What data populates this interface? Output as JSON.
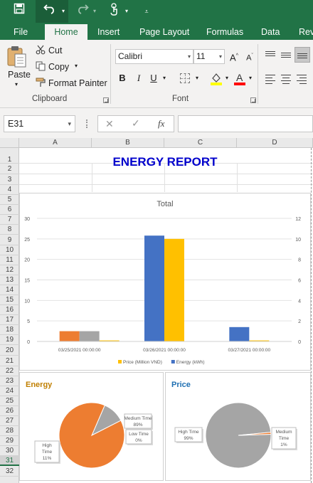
{
  "quick_access": {
    "save_icon": "save-icon",
    "undo_icon": "undo-icon",
    "redo_icon": "redo-icon",
    "touch_icon": "touch-mode-icon",
    "customize_icon": "customize-qat-icon"
  },
  "tabs": [
    "File",
    "Home",
    "Insert",
    "Page Layout",
    "Formulas",
    "Data",
    "Revi"
  ],
  "active_tab": "Home",
  "clipboard": {
    "paste": "Paste",
    "cut": "Cut",
    "copy": "Copy",
    "format_painter": "Format Painter",
    "group_label": "Clipboard"
  },
  "font": {
    "family": "Calibri",
    "size": "11",
    "bold": "B",
    "italic": "I",
    "underline": "U",
    "group_label": "Font"
  },
  "formula_bar": {
    "name_box": "E31",
    "fx": "fx",
    "cancel": "✕",
    "enter": "✓",
    "formula": ""
  },
  "columns": [
    "A",
    "B",
    "C",
    "D"
  ],
  "rows": [
    "1",
    "2",
    "3",
    "4",
    "5",
    "6",
    "7",
    "8",
    "9",
    "10",
    "11",
    "12",
    "13",
    "14",
    "15",
    "16",
    "17",
    "18",
    "19",
    "20",
    "21",
    "22",
    "23",
    "24",
    "25",
    "26",
    "27",
    "28",
    "29",
    "30",
    "31",
    "32"
  ],
  "active_row": "31",
  "sheet_title": "ENERGY REPORT",
  "chart_data": [
    {
      "type": "bar",
      "title": "Total",
      "categories": [
        "03/25/2021 00:00:00",
        "03/26/2021 00:00:00",
        "03/27/2021 00:00:00"
      ],
      "series": [
        {
          "name": "Energy (kWh)",
          "axis": "left",
          "values": [
            2.5,
            25.8,
            3.5
          ]
        },
        {
          "name": "Price (Million VND)",
          "axis": "right",
          "values": [
            0.1,
            10.0,
            0.1
          ]
        }
      ],
      "extra_bars": [
        {
          "category": "03/25/2021 00:00:00",
          "value": 2.5
        }
      ],
      "y_left_ticks": [
        "0",
        "5",
        "10",
        "15",
        "20",
        "25",
        "30"
      ],
      "y_right_ticks": [
        "0",
        "2",
        "4",
        "6",
        "8",
        "10",
        "12"
      ],
      "ylim_left": [
        0,
        30
      ],
      "ylim_right": [
        0,
        12
      ],
      "legend": [
        {
          "name": "Price (Million VND)",
          "color": "#ffc000"
        },
        {
          "name": "Energy (kWh)",
          "color": "#4472c4"
        }
      ],
      "legend_position": "bottom",
      "colors": {
        "energy": "#4472c4",
        "price": "#ffc000",
        "energy_first": "#ed7d31",
        "extra": "#a5a5a5"
      }
    },
    {
      "type": "pie",
      "title": "Energy",
      "slices": [
        {
          "label": "Medium Time",
          "percent": "89%",
          "value": 89,
          "color": "#ed7d31"
        },
        {
          "label": "High Time",
          "percent": "11%",
          "value": 11,
          "color": "#a5a5a5"
        },
        {
          "label": "Low Time",
          "percent": "0%",
          "value": 0,
          "color": "#4472c4"
        }
      ]
    },
    {
      "type": "pie",
      "title": "Price",
      "slices": [
        {
          "label": "High Time",
          "percent": "99%",
          "value": 99,
          "color": "#a5a5a5"
        },
        {
          "label": "Medium Time",
          "percent": "1%",
          "value": 1,
          "color": "#ed7d31"
        }
      ]
    }
  ],
  "colors": {
    "excel_green": "#217346",
    "title_blue": "#0000cc",
    "energy_title": "#c07f00",
    "price_title": "#1f6fb2"
  }
}
